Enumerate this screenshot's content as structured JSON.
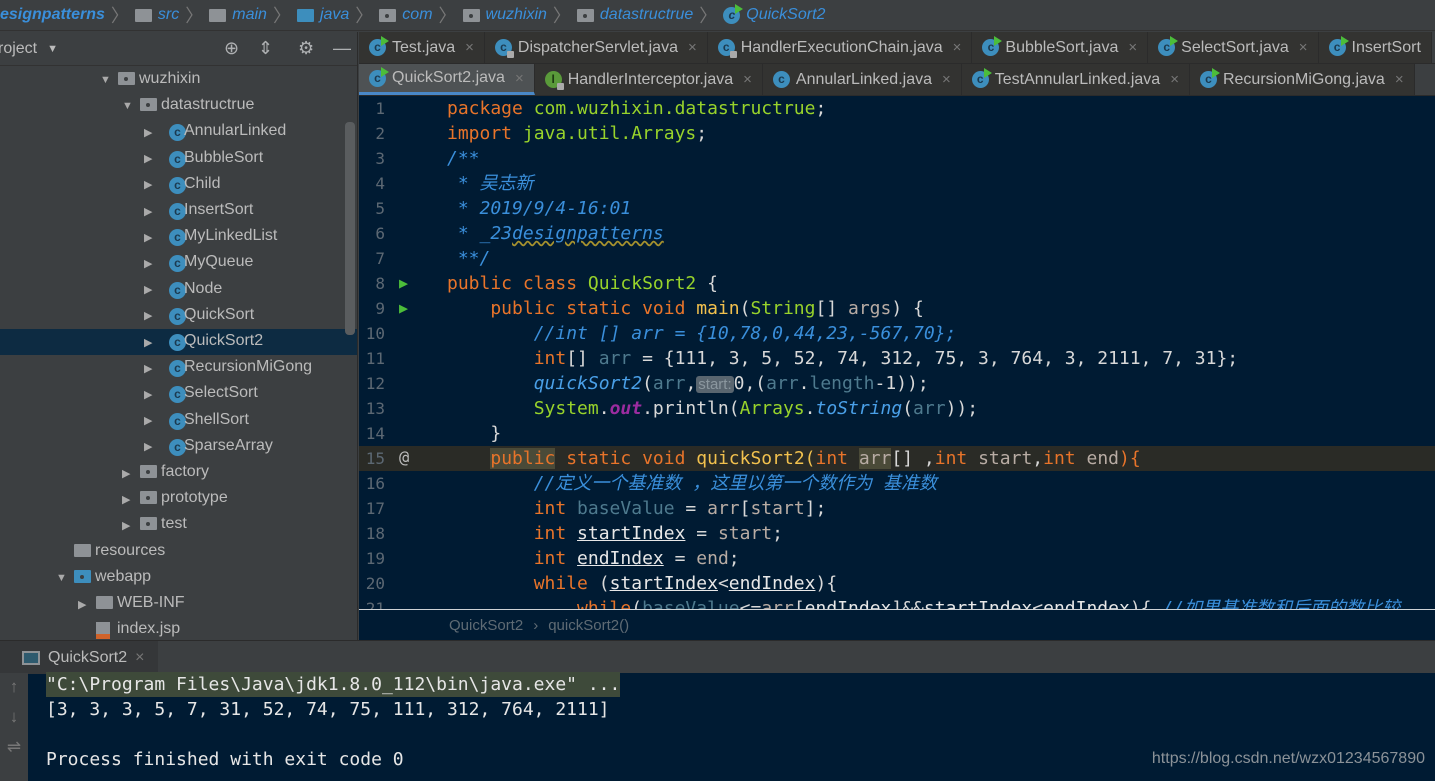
{
  "breadcrumbs": [
    {
      "label": "esignpatterns",
      "icon": "none"
    },
    {
      "label": "src",
      "icon": "folder"
    },
    {
      "label": "main",
      "icon": "folder"
    },
    {
      "label": "java",
      "icon": "folder-blue"
    },
    {
      "label": "com",
      "icon": "package"
    },
    {
      "label": "wuzhixin",
      "icon": "package"
    },
    {
      "label": "datastructrue",
      "icon": "package"
    },
    {
      "label": "QuickSort2",
      "icon": "class-run"
    }
  ],
  "project_panel": {
    "title": "roject",
    "icons": [
      "locate-icon",
      "collapse-icon",
      "gear-icon",
      "minimize-icon"
    ]
  },
  "tree": [
    {
      "label": "wuzhixin",
      "type": "package",
      "arrow": "down",
      "indent": 1
    },
    {
      "label": "datastructrue",
      "type": "package",
      "arrow": "down",
      "indent": 2
    },
    {
      "label": "AnnularLinked",
      "type": "class",
      "arrow": "right",
      "indent": 3
    },
    {
      "label": "BubbleSort",
      "type": "class",
      "arrow": "right",
      "indent": 3
    },
    {
      "label": "Child",
      "type": "class",
      "arrow": "right",
      "indent": 3
    },
    {
      "label": "InsertSort",
      "type": "class",
      "arrow": "right",
      "indent": 3
    },
    {
      "label": "MyLinkedList",
      "type": "class",
      "arrow": "right",
      "indent": 3
    },
    {
      "label": "MyQueue",
      "type": "class",
      "arrow": "right",
      "indent": 3
    },
    {
      "label": "Node",
      "type": "class",
      "arrow": "right",
      "indent": 3
    },
    {
      "label": "QuickSort",
      "type": "class",
      "arrow": "right",
      "indent": 3
    },
    {
      "label": "QuickSort2",
      "type": "class",
      "arrow": "right",
      "indent": 3,
      "selected": true
    },
    {
      "label": "RecursionMiGong",
      "type": "class",
      "arrow": "right",
      "indent": 3
    },
    {
      "label": "SelectSort",
      "type": "class",
      "arrow": "right",
      "indent": 3
    },
    {
      "label": "ShellSort",
      "type": "class",
      "arrow": "right",
      "indent": 3
    },
    {
      "label": "SparseArray",
      "type": "class",
      "arrow": "right",
      "indent": 3
    },
    {
      "label": "factory",
      "type": "package",
      "arrow": "right",
      "indent": 2
    },
    {
      "label": "prototype",
      "type": "package",
      "arrow": "right",
      "indent": 2
    },
    {
      "label": "test",
      "type": "package",
      "arrow": "right",
      "indent": 2
    },
    {
      "label": "resources",
      "type": "folder",
      "arrow": "none",
      "indent": -1
    },
    {
      "label": "webapp",
      "type": "package-blue",
      "arrow": "down",
      "indent": -1
    },
    {
      "label": "WEB-INF",
      "type": "folder",
      "arrow": "right",
      "indent": 0
    },
    {
      "label": "index.jsp",
      "type": "jsp",
      "arrow": "none",
      "indent": 0
    }
  ],
  "tabs_row1": [
    {
      "label": "Test.java",
      "icon": "class-run"
    },
    {
      "label": "DispatcherServlet.java",
      "icon": "class-lock"
    },
    {
      "label": "HandlerExecutionChain.java",
      "icon": "class-lock"
    },
    {
      "label": "BubbleSort.java",
      "icon": "class-run"
    },
    {
      "label": "SelectSort.java",
      "icon": "class-run"
    },
    {
      "label": "InsertSort",
      "icon": "class-run"
    }
  ],
  "tabs_row2": [
    {
      "label": "QuickSort2.java",
      "icon": "class-run",
      "active": true
    },
    {
      "label": "HandlerInterceptor.java",
      "icon": "interface-lock"
    },
    {
      "label": "AnnularLinked.java",
      "icon": "class"
    },
    {
      "label": "TestAnnularLinked.java",
      "icon": "class-run"
    },
    {
      "label": "RecursionMiGong.java",
      "icon": "class-run"
    }
  ],
  "code": [
    {
      "n": "1",
      "t": [
        [
          "package ",
          "k"
        ],
        [
          "com.wuzhixin.datastructrue",
          "g"
        ],
        [
          ";",
          "t"
        ]
      ]
    },
    {
      "n": "2",
      "t": [
        [
          "import ",
          "k"
        ],
        [
          "java.util.Arrays",
          "g"
        ],
        [
          ";",
          "t"
        ]
      ]
    },
    {
      "n": "3",
      "t": [
        [
          "/**",
          "c"
        ]
      ]
    },
    {
      "n": "4",
      "t": [
        [
          " * 吴志新",
          "c"
        ]
      ]
    },
    {
      "n": "5",
      "t": [
        [
          " * 2019/9/4-16:01",
          "c"
        ]
      ]
    },
    {
      "n": "6",
      "t": [
        [
          " * _23",
          "c"
        ],
        [
          "designpatterns",
          "cw"
        ]
      ]
    },
    {
      "n": "7",
      "t": [
        [
          " **/",
          "c"
        ]
      ]
    },
    {
      "n": "8",
      "gutter": "run",
      "t": [
        [
          "public class ",
          "k"
        ],
        [
          "QuickSort2",
          "g"
        ],
        [
          " {",
          "t"
        ]
      ]
    },
    {
      "n": "9",
      "gutter": "run",
      "t": [
        [
          "    public static void ",
          "k"
        ],
        [
          "main",
          "m"
        ],
        [
          "(",
          "t"
        ],
        [
          "String",
          "g"
        ],
        [
          "[] ",
          "t"
        ],
        [
          "args",
          "p"
        ],
        [
          ") {",
          "t"
        ]
      ]
    },
    {
      "n": "10",
      "t": [
        [
          "        //int [] arr = {10,78,0,44,23,-567,70};",
          "c"
        ]
      ]
    },
    {
      "n": "11",
      "t": [
        [
          "        int",
          "k"
        ],
        [
          "[] ",
          "t"
        ],
        [
          "arr",
          "v"
        ],
        [
          " = {111, 3, 5, 52, 74, 312, 75, 3, 764, 3, 2111, 7, 31};",
          "t"
        ]
      ]
    },
    {
      "n": "12",
      "t": [
        [
          "        quickSort2",
          "i"
        ],
        [
          "(",
          "t"
        ],
        [
          "arr",
          "v"
        ],
        [
          ",",
          "t"
        ],
        [
          "start:",
          "h"
        ],
        [
          "0,(",
          "t"
        ],
        [
          "arr",
          "v"
        ],
        [
          ".",
          "t"
        ],
        [
          "length",
          "v"
        ],
        [
          "-1));",
          "t"
        ]
      ]
    },
    {
      "n": "13",
      "t": [
        [
          "        System",
          "g"
        ],
        [
          ".",
          "t"
        ],
        [
          "out",
          "o"
        ],
        [
          ".println(",
          "t"
        ],
        [
          "Arrays",
          "g"
        ],
        [
          ".",
          "t"
        ],
        [
          "toString",
          "i"
        ],
        [
          "(",
          "t"
        ],
        [
          "arr",
          "v"
        ],
        [
          "));",
          "t"
        ]
      ]
    },
    {
      "n": "14",
      "t": [
        [
          "    }",
          "t"
        ]
      ]
    },
    {
      "n": "15",
      "gutter": "override",
      "current": true,
      "t": [
        [
          "    ",
          "t"
        ],
        [
          "public",
          "k hl"
        ],
        [
          " static void ",
          "k"
        ],
        [
          "quickSort2",
          "m"
        ],
        [
          "(",
          "m"
        ],
        [
          "int ",
          "k"
        ],
        [
          "arr",
          "p hl"
        ],
        [
          "[] ,",
          "t"
        ],
        [
          "int ",
          "k"
        ],
        [
          "start",
          "p"
        ],
        [
          ",",
          "t"
        ],
        [
          "int ",
          "k"
        ],
        [
          "end",
          "p"
        ],
        [
          "){",
          "k"
        ]
      ]
    },
    {
      "n": "16",
      "t": [
        [
          "        //定义一个基准数 ，这里以第一个数作为 基准数",
          "c"
        ]
      ]
    },
    {
      "n": "17",
      "t": [
        [
          "        int ",
          "k"
        ],
        [
          "baseValue",
          "v"
        ],
        [
          " = ",
          "t"
        ],
        [
          "arr",
          "p"
        ],
        [
          "[",
          "t"
        ],
        [
          "start",
          "p"
        ],
        [
          "];",
          "t"
        ]
      ]
    },
    {
      "n": "18",
      "t": [
        [
          "        int ",
          "k"
        ],
        [
          "startIndex",
          "u"
        ],
        [
          " = ",
          "t"
        ],
        [
          "start",
          "p"
        ],
        [
          ";",
          "t"
        ]
      ]
    },
    {
      "n": "19",
      "t": [
        [
          "        int ",
          "k"
        ],
        [
          "endIndex",
          "u"
        ],
        [
          " = ",
          "t"
        ],
        [
          "end",
          "p"
        ],
        [
          ";",
          "t"
        ]
      ]
    },
    {
      "n": "20",
      "t": [
        [
          "        while ",
          "k"
        ],
        [
          "(",
          "t"
        ],
        [
          "startIndex",
          "u"
        ],
        [
          "<",
          "t"
        ],
        [
          "endIndex",
          "u"
        ],
        [
          "){",
          "t"
        ]
      ]
    },
    {
      "n": "21",
      "t": [
        [
          "            while",
          "k"
        ],
        [
          "(",
          "t"
        ],
        [
          "baseValue",
          "v"
        ],
        [
          "<=",
          "t"
        ],
        [
          "arr",
          "p"
        ],
        [
          "[",
          "t"
        ],
        [
          "endIndex",
          "u"
        ],
        [
          "]&&",
          "t"
        ],
        [
          "startIndex",
          "u"
        ],
        [
          "<",
          "t"
        ],
        [
          "endIndex",
          "u"
        ],
        [
          "){ ",
          "t"
        ],
        [
          "//如果基准数和后面的数比较",
          "c"
        ]
      ]
    }
  ],
  "editor_breadcrumb": {
    "class": "QuickSort2",
    "method": "quickSort2()"
  },
  "run": {
    "tab_label": "QuickSort2",
    "lines": [
      "\"C:\\Program Files\\Java\\jdk1.8.0_112\\bin\\java.exe\" ...",
      "[3, 3, 3, 5, 7, 31, 52, 74, 75, 111, 312, 764, 2111]",
      "",
      "Process finished with exit code 0"
    ]
  },
  "watermark": "https://blog.csdn.net/wzx01234567890"
}
